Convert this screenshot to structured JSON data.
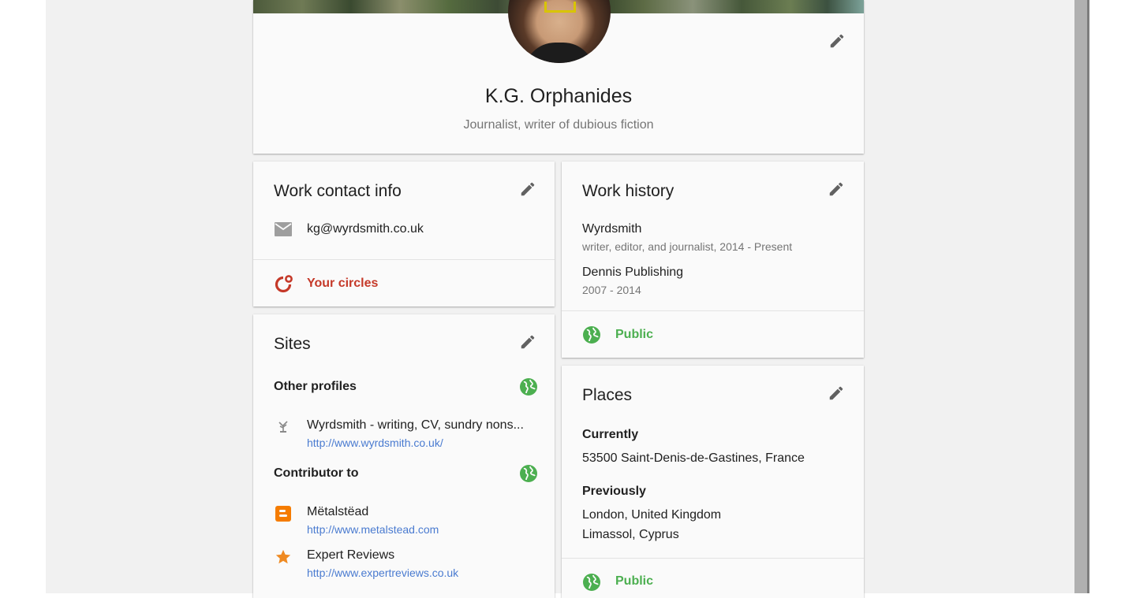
{
  "profile": {
    "name": "K.G. Orphanides",
    "tagline": "Journalist, writer of dubious fiction"
  },
  "contact": {
    "title": "Work contact info",
    "email": "kg@wyrdsmith.co.uk",
    "circles_label": "Your circles"
  },
  "sites": {
    "title": "Sites",
    "other_profiles_heading": "Other profiles",
    "contributor_heading": "Contributor to",
    "other_profiles": [
      {
        "title": "Wyrdsmith - writing, CV, sundry nons...",
        "url": "http://www.wyrdsmith.co.uk/",
        "icon": "tree-icon"
      }
    ],
    "contributor": [
      {
        "title": "Mëtalstëad",
        "url": "http://www.metalstead.com",
        "icon": "blogger-icon"
      },
      {
        "title": "Expert Reviews",
        "url": "http://www.expertreviews.co.uk",
        "icon": "star-icon"
      }
    ]
  },
  "work_history": {
    "title": "Work history",
    "jobs": [
      {
        "company": "Wyrdsmith",
        "detail": "writer, editor, and journalist, 2014 - Present"
      },
      {
        "company": "Dennis Publishing",
        "detail": "2007 - 2014"
      }
    ],
    "visibility": "Public"
  },
  "places": {
    "title": "Places",
    "currently_heading": "Currently",
    "current": "53500 Saint-Denis-de-Gastines, France",
    "previously_heading": "Previously",
    "previous": [
      "London, United Kingdom",
      "Limassol, Cyprus"
    ],
    "visibility": "Public"
  },
  "colors": {
    "accent_red": "#c53929",
    "public_green": "#4caf50",
    "link_blue": "#4a7bd0"
  }
}
